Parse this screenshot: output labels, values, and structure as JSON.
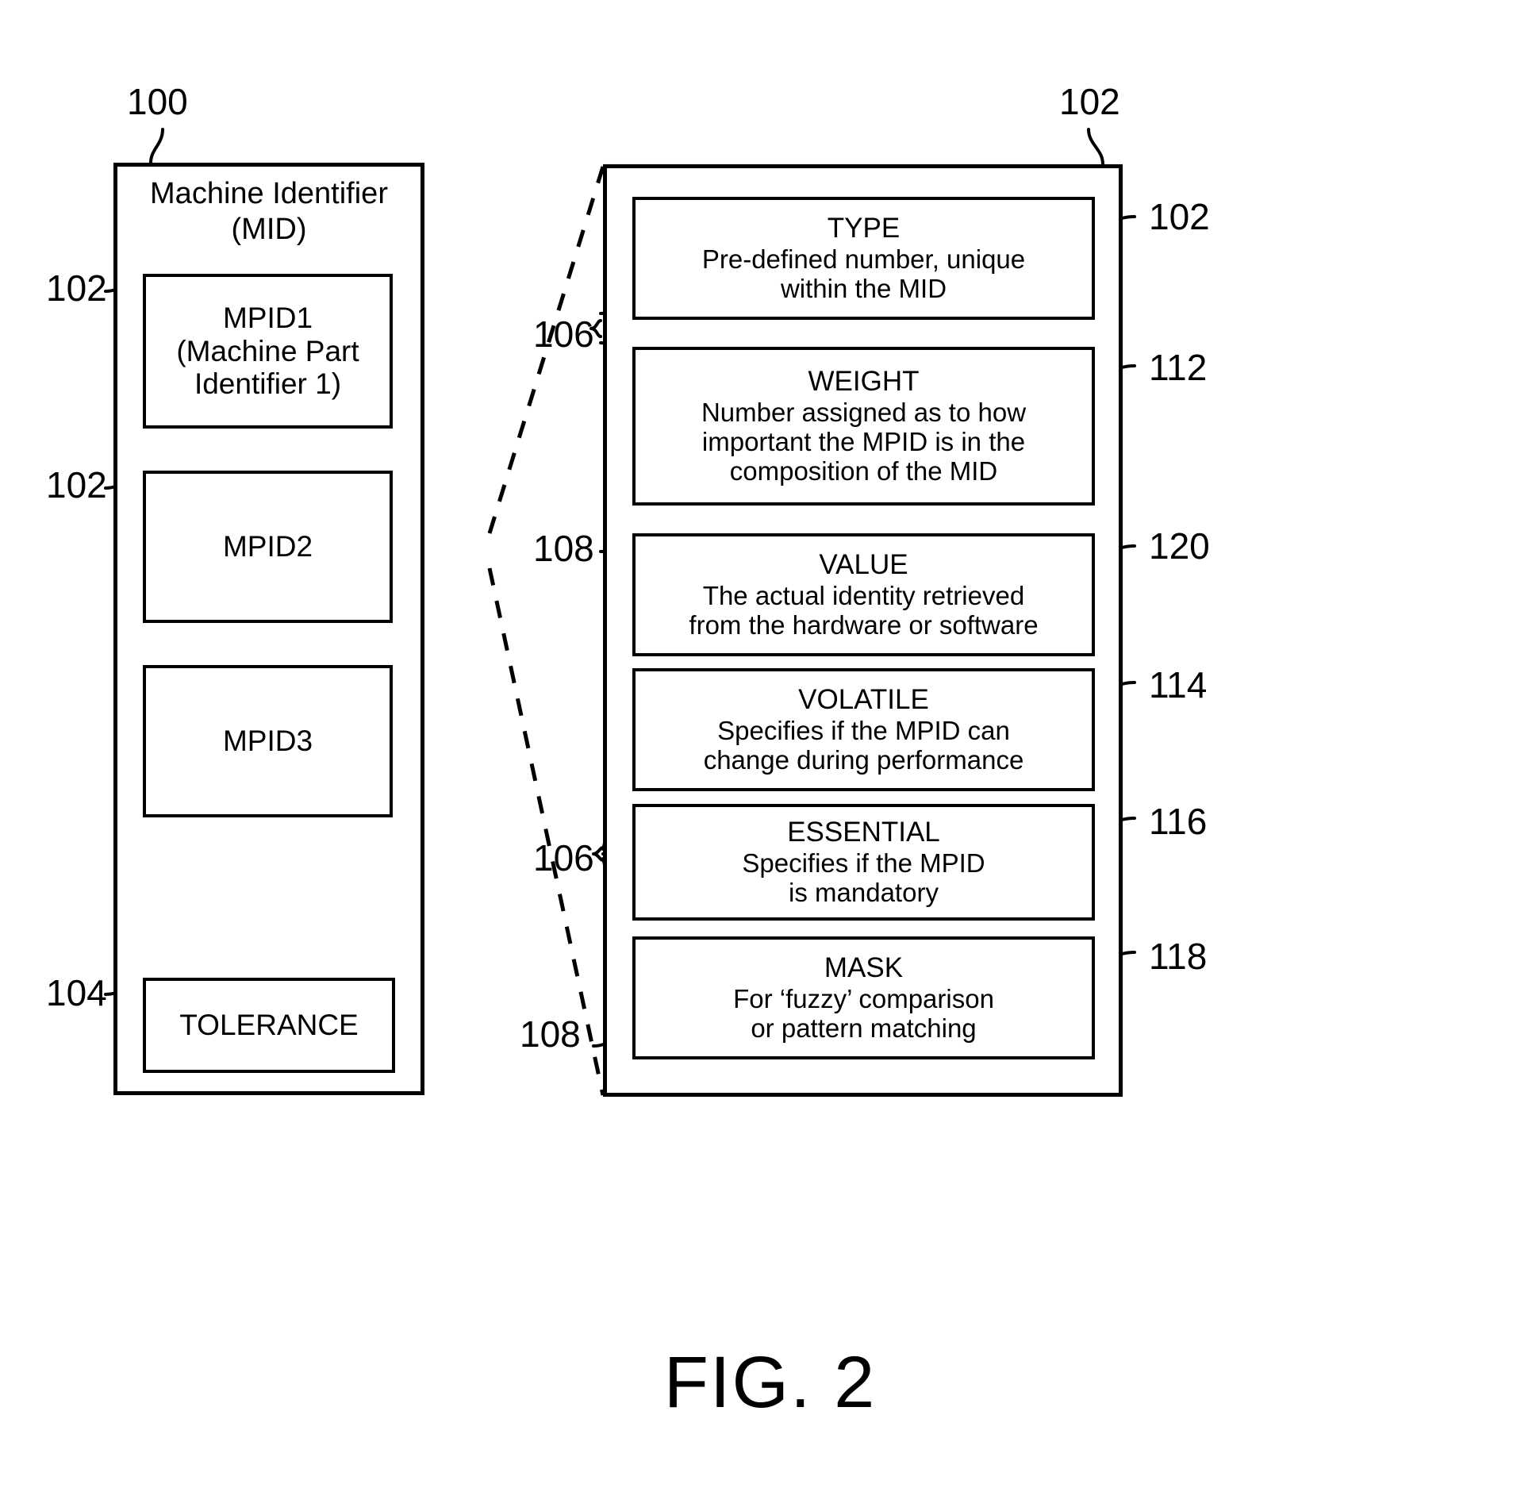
{
  "figure": {
    "caption": "FIG. 2"
  },
  "left_panel": {
    "title_line1": "Machine Identifier",
    "title_line2": "(MID)",
    "ref_top": "100",
    "items": [
      {
        "ref": "102",
        "line1": "MPID1",
        "line2": "(Machine Part",
        "line3": "Identifier 1)"
      },
      {
        "ref": "102",
        "line1": "MPID2",
        "line2": "",
        "line3": ""
      },
      {
        "ref": "",
        "line1": "MPID3",
        "line2": "",
        "line3": ""
      }
    ],
    "tolerance": {
      "ref": "104",
      "label": "TOLERANCE"
    }
  },
  "right_panel": {
    "ref_top": "102",
    "fields": [
      {
        "ref": "102",
        "heading": "TYPE",
        "desc_line1": "Pre-defined number, unique",
        "desc_line2": "within the MID",
        "desc_line3": ""
      },
      {
        "ref": "112",
        "heading": "WEIGHT",
        "desc_line1": "Number assigned as to how",
        "desc_line2": "important the MPID is in the",
        "desc_line3": "composition of the MID"
      },
      {
        "ref": "120",
        "heading": "VALUE",
        "desc_line1": "The actual identity retrieved",
        "desc_line2": "from the hardware or software",
        "desc_line3": ""
      },
      {
        "ref": "114",
        "heading": "VOLATILE",
        "desc_line1": "Specifies if the MPID can",
        "desc_line2": "change during performance",
        "desc_line3": ""
      },
      {
        "ref": "116",
        "heading": "ESSENTIAL",
        "desc_line1": "Specifies if the MPID",
        "desc_line2": "is mandatory",
        "desc_line3": ""
      },
      {
        "ref": "118",
        "heading": "MASK",
        "desc_line1": "For ‘fuzzy’ comparison",
        "desc_line2": "or pattern matching",
        "desc_line3": ""
      }
    ],
    "brace_refs": {
      "brace_106_upper": "106",
      "brace_108_value": "108",
      "brace_106_lower": "106",
      "brace_108_mask": "108"
    }
  },
  "style": {
    "ink": "#000000",
    "paper": "#ffffff"
  }
}
